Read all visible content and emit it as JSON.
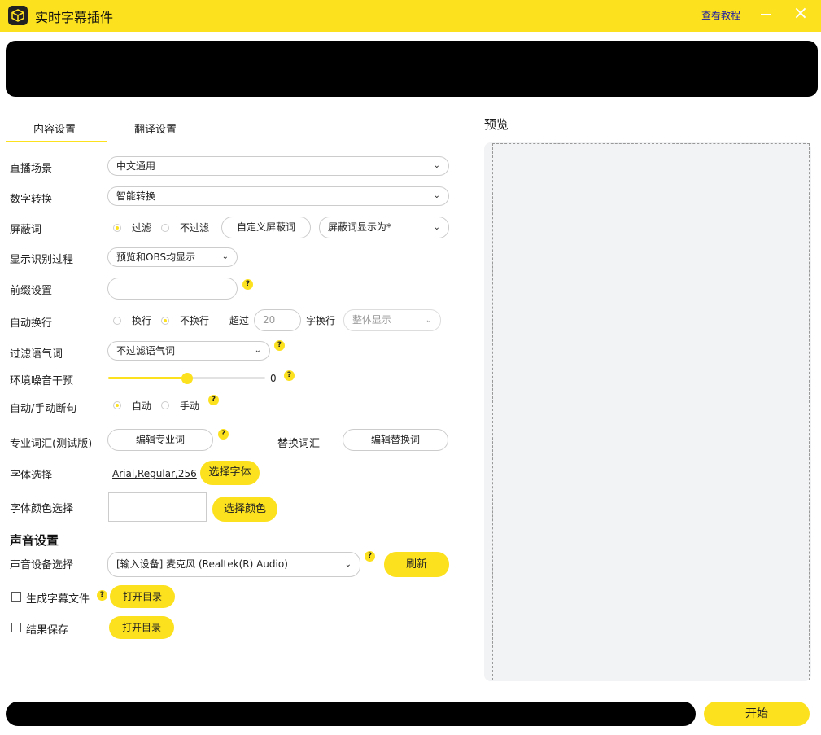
{
  "app": {
    "title": "实时字幕插件",
    "help_link": "查看教程",
    "accent_color": "#fce11f"
  },
  "tabs": [
    {
      "label": "内容设置",
      "active": true
    },
    {
      "label": "翻译设置",
      "active": false
    }
  ],
  "content": {
    "live_scene": {
      "label": "直播场景",
      "value": "中文通用"
    },
    "number_conversion": {
      "label": "数字转换",
      "value": "智能转换"
    },
    "blocked_words": {
      "label": "屏蔽词",
      "options": [
        "过滤",
        "不过滤"
      ],
      "selected": "过滤",
      "custom_button": "自定义屏蔽词",
      "display_as": "屏蔽词显示为*"
    },
    "show_recognition": {
      "label": "显示识别过程",
      "value": "预览和OBS均显示"
    },
    "prefix": {
      "label": "前缀设置",
      "value": ""
    },
    "auto_wrap": {
      "label": "自动换行",
      "options": [
        "换行",
        "不换行"
      ],
      "selected": "不换行",
      "exceed_label": "超过",
      "exceed_value": "20",
      "wrap_suffix": "字换行",
      "mode": "整体显示"
    },
    "filter_filler": {
      "label": "过滤语气词",
      "value": "不过滤语气词"
    },
    "noise": {
      "label": "环境噪音干预",
      "value": "0",
      "level": 0.5
    },
    "segmentation": {
      "label": "自动/手动断句",
      "options": [
        "自动",
        "手动"
      ],
      "selected": "自动"
    },
    "vocab": {
      "label": "专业词汇(测试版)",
      "edit_button": "编辑专业词",
      "replace_label": "替换词汇",
      "replace_button": "编辑替换词"
    },
    "font": {
      "label": "字体选择",
      "value": "Arial,Regular,256",
      "button": "选择字体"
    },
    "font_color": {
      "label": "字体颜色选择",
      "value": "#ffffff",
      "button": "选择颜色"
    }
  },
  "sound": {
    "section_title": "声音设置",
    "device_label": "声音设备选择",
    "device_value": "[输入设备] 麦克风 (Realtek(R) Audio)",
    "refresh_button": "刷新"
  },
  "files": {
    "generate_subtitle": {
      "label": "生成字幕文件",
      "checked": false,
      "button": "打开目录"
    },
    "save_result": {
      "label": "结果保存",
      "checked": false,
      "button": "打开目录"
    }
  },
  "preview": {
    "label": "预览"
  },
  "footer": {
    "start_button": "开始"
  }
}
